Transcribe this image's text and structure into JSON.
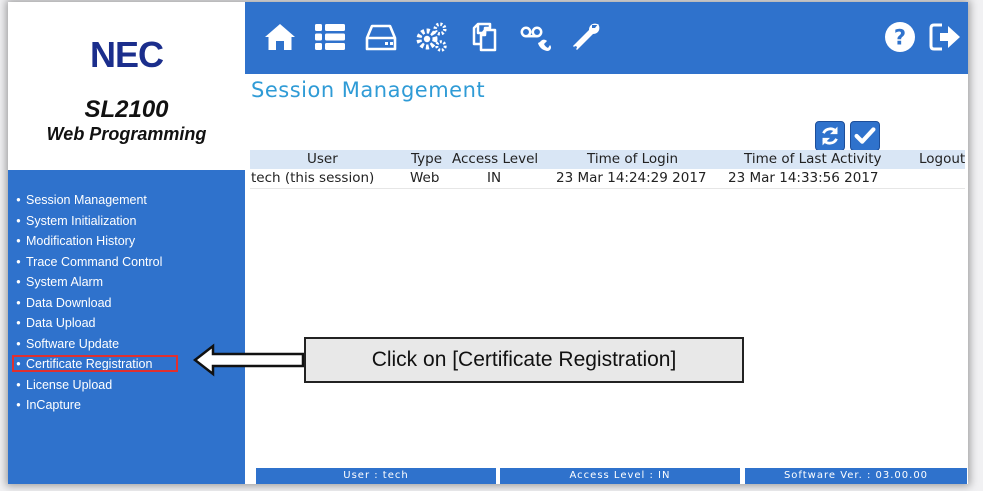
{
  "brand": {
    "logo": "NEC",
    "product": "SL2100",
    "subtitle": "Web Programming"
  },
  "toolbar": {
    "icons": [
      "home-icon",
      "list-icon",
      "drive-icon",
      "gears-icon",
      "copy-icon",
      "voicemail-icon",
      "wrench-icon",
      "help-icon",
      "logout-icon"
    ]
  },
  "page": {
    "title": "Session Management"
  },
  "actions": {
    "refresh_icon": "refresh-icon",
    "apply_icon": "check-icon"
  },
  "nav": {
    "items": [
      "Session Management",
      "System Initialization",
      "Modification History",
      "Trace Command Control",
      "System Alarm",
      "Data Download",
      "Data Upload",
      "Software Update",
      "Certificate Registration",
      "License Upload",
      "InCapture"
    ],
    "highlighted": "Certificate Registration"
  },
  "session_table": {
    "headers": [
      "User",
      "Type",
      "Access Level",
      "Time of Login",
      "Time of Last Activity",
      "Logout"
    ],
    "rows": [
      [
        "tech (this session)",
        "Web",
        "IN",
        "23 Mar 14:24:29 2017",
        "23 Mar 14:33:56 2017",
        ""
      ]
    ]
  },
  "status_bar": {
    "user": "User : tech",
    "access_level": "Access Level : IN",
    "software_version": "Software Ver. : 03.00.00"
  },
  "callout": {
    "text": "Click on [Certificate Registration]"
  },
  "colors": {
    "primary_blue": "#2f72cc",
    "title_blue": "#2f9bd6",
    "highlight_red": "#e0302e",
    "header_row": "#d9e6f5"
  }
}
